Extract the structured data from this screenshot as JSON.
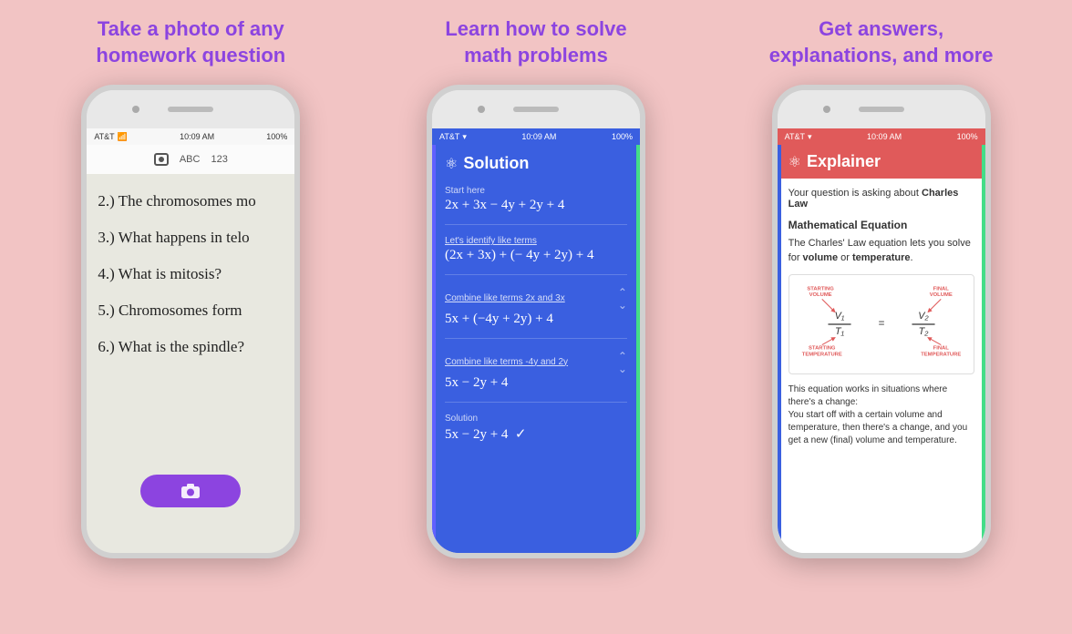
{
  "columns": [
    {
      "id": "col1",
      "title": "Take a photo of any\nhomework question",
      "phone": {
        "status": {
          "carrier": "AT&T",
          "wifi": "▾",
          "time": "10:09 AM",
          "battery": "100%"
        },
        "toolbar": {
          "icon_label": "camera",
          "text1": "ABC",
          "text2": "123"
        },
        "items": [
          "2.) The chromosomes mo",
          "3.) What happens in telo",
          "4.) What is mitosis?",
          "5.) Chromosomes form",
          "6.) What is the spindle?"
        ],
        "cta": "📷"
      }
    },
    {
      "id": "col2",
      "title": "Learn how to solve\nmath problems",
      "phone": {
        "status": {
          "carrier": "AT&T",
          "wifi": "▾",
          "time": "10:09 AM",
          "battery": "100%"
        },
        "header_title": "Solution",
        "steps": [
          {
            "label": "Start here",
            "expression": "2x + 3x − 4y + 2y + 4",
            "has_divider": true
          },
          {
            "label": "Let's identify like terms",
            "label_underline": true,
            "expression": "(2x + 3x) + (− 4y + 2y) + 4",
            "has_divider": true
          },
          {
            "label": "Combine like terms 2x and 3x",
            "label_underline": true,
            "expression": "5x + (−4y + 2y) + 4",
            "has_divider": true,
            "has_arrow": true
          },
          {
            "label": "Combine like terms -4y and 2y",
            "label_underline": true,
            "expression": "5x − 2y + 4",
            "has_divider": true,
            "has_arrow": true
          },
          {
            "label": "Solution",
            "expression": "5x − 2y + 4  ✓",
            "has_divider": false,
            "has_arrow": false
          }
        ]
      }
    },
    {
      "id": "col3",
      "title": "Get answers,\nexplanations, and more",
      "phone": {
        "status": {
          "carrier": "AT&T",
          "wifi": "▾",
          "time": "10:09 AM",
          "battery": "100%"
        },
        "header_title": "Explainer",
        "intro": "Your question is asking about",
        "topic": "Charles Law",
        "section_title": "Mathematical Equation",
        "desc1": "The Charles' Law equation lets you solve for",
        "desc1_bold1": "volume",
        "desc1_middle": " or ",
        "desc1_bold2": "temperature",
        "desc1_end": ".",
        "diagram_labels": {
          "top_left": "STARTING\nVOLUME",
          "top_right": "FINAL\nVOLUME",
          "bottom_left": "STARTING\nTEMPERATURE",
          "bottom_right": "FINAL\nTEMPERATURE",
          "v1": "V₁",
          "v2": "V₂",
          "t1": "T₁",
          "t2": "T₂",
          "equals": "="
        },
        "footer": "This equation works in situations where there's a change:\nYou start off with a certain volume and temperature, then there's a change, and you get a new (final) volume and temperature."
      }
    }
  ]
}
